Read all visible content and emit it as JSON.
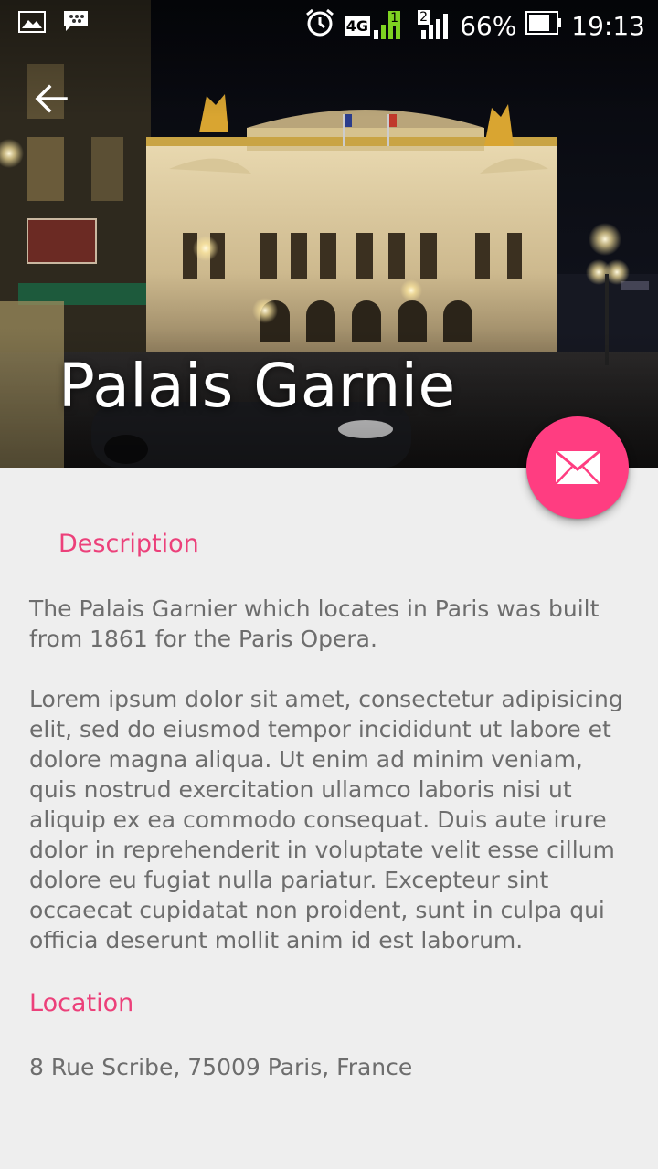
{
  "status_bar": {
    "network_label": "4G",
    "sim1_label": "1",
    "sim2_label": "2",
    "battery_percent": "66%",
    "time": "19:13"
  },
  "header": {
    "title": "Palais Garnie",
    "image_icon": "palace-photo",
    "back_icon": "arrow-left-icon",
    "fab_icon": "envelope-icon"
  },
  "description": {
    "heading": "Description",
    "paragraph1": "The Palais Garnier which locates in Paris was built from 1861 for the Paris Opera.",
    "paragraph2": "Lorem ipsum dolor sit amet, consectetur adipisicing elit, sed do eiusmod tempor incididunt ut labore et dolore magna aliqua. Ut enim ad minim veniam, quis nostrud exercitation ullamco laboris nisi ut aliquip ex ea commodo consequat. Duis aute irure dolor in reprehenderit in voluptate velit esse cillum dolore eu fugiat nulla pariatur. Excepteur sint occaecat cupidatat non proident, sunt in culpa qui officia deserunt mollit anim id est laborum."
  },
  "location": {
    "heading": "Location",
    "address": "8 Rue Scribe, 75009 Paris, France"
  },
  "colors": {
    "accent": "#ec407a",
    "fab": "#ff3d81",
    "body_text": "#6d6d6d",
    "background": "#eeeeee"
  }
}
